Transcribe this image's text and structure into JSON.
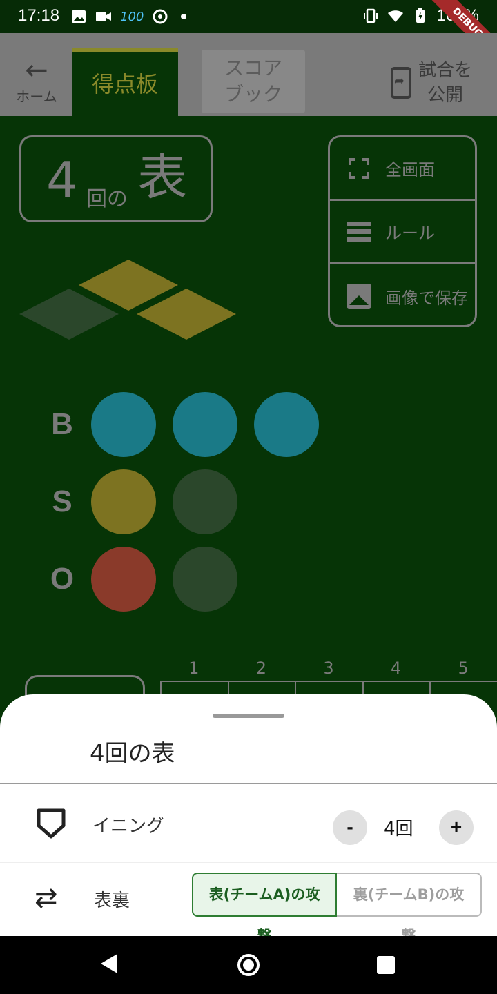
{
  "status_bar": {
    "time": "17:18",
    "battery": "100%",
    "signal_badge": "100",
    "debug_banner": "DEBUG"
  },
  "top_bar": {
    "back_label": "ホーム",
    "tab_scoreboard": "得点板",
    "tab_scorebook_line1": "スコア",
    "tab_scorebook_line2": "ブック",
    "publish_line1": "試合を",
    "publish_line2": "公開"
  },
  "inning_display": {
    "number": "4",
    "no": "回の",
    "half": "表"
  },
  "side_menu": {
    "fullscreen": "全画面",
    "rules": "ルール",
    "save_image": "画像で保存"
  },
  "count": {
    "ball_label": "B",
    "strike_label": "S",
    "out_label": "O",
    "balls": 3,
    "balls_max": 3,
    "strikes": 1,
    "strikes_max": 2,
    "outs": 1,
    "outs_max": 2
  },
  "bases": {
    "first": true,
    "second": true,
    "third": false
  },
  "colors": {
    "field": "#063406",
    "ball_on": "#1a7a87",
    "strike_on": "#7d7321",
    "out_on": "#8a3a2a",
    "off": "#2b472b",
    "base_on": "#7d7321",
    "base_off": "#2b472b"
  },
  "scoreboard_innings": [
    "1",
    "2",
    "3",
    "4",
    "5"
  ],
  "sheet": {
    "title": "4回の表",
    "inning_label": "イニング",
    "inning_value": "4回",
    "minus": "-",
    "plus": "+",
    "half_label": "表裏",
    "top_option": "表(チームA)の攻撃",
    "bottom_option": "裏(チームB)の攻撃"
  }
}
